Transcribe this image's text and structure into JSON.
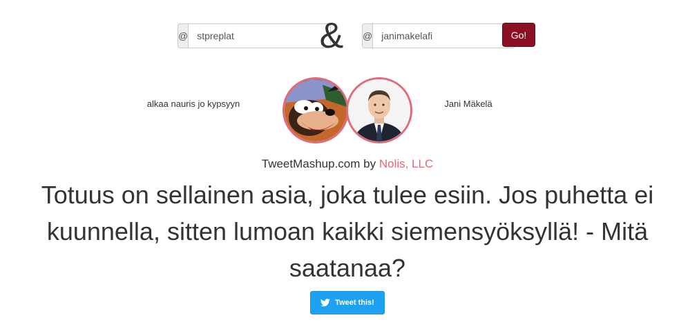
{
  "form": {
    "left_prefix": "@",
    "left_value": "stpreplat",
    "separator": "&",
    "right_prefix": "@",
    "right_value": "janimakelafi",
    "go_label": "Go!"
  },
  "users": {
    "left_name": "alkaa nauris jo kypsyyn",
    "right_name": "Jani Mäkelä"
  },
  "credit": {
    "prefix": "TweetMashup.com by ",
    "link_text": "Nolis, LLC"
  },
  "mashup": {
    "text": "Totuus on sellainen asia, joka tulee esiin. Jos puhetta ei kuunnella, sitten lumoan kaikki siemensyöksyllä! - Mitä saatanaa?"
  },
  "tweet": {
    "label": "Tweet this!"
  },
  "colors": {
    "accent": "#e06a7a",
    "go_button": "#8b1025",
    "tweet_button": "#1da1f2"
  },
  "icons": {
    "tweet_button_icon": "twitter-bird-icon",
    "left_avatar": "cartoon-dog-avatar",
    "right_avatar": "man-in-suit-avatar"
  }
}
